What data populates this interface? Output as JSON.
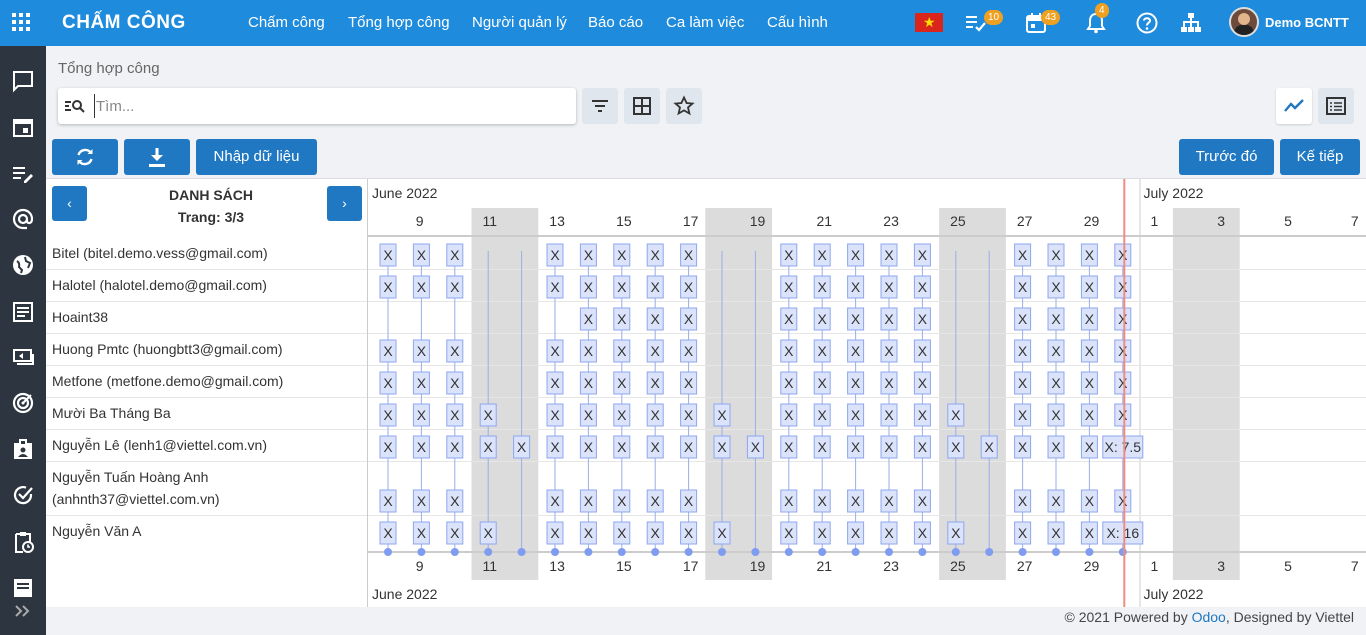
{
  "app": {
    "brand": "CHẤM CÔNG",
    "menu": [
      "Chấm công",
      "Tổng hợp công",
      "Người quản lý",
      "Báo cáo",
      "Ca làm việc",
      "Cấu hình"
    ],
    "badges": {
      "activities": "10",
      "calendar": "43",
      "notifications": "4"
    },
    "user": "Demo BCNTT",
    "accent_color": "#1e8bdc",
    "button_color": "#1f78c1",
    "icons": [
      "apps-grid-icon",
      "vietnam-flag-icon",
      "activity-check-icon",
      "calendar-icon",
      "bell-icon",
      "help-icon",
      "org-chart-icon"
    ]
  },
  "sidebar": {
    "icons": [
      "chat-icon",
      "calendar-icon",
      "notes-icon",
      "at-sign-icon",
      "globe-icon",
      "document-icon",
      "payment-icon",
      "radar-icon",
      "badge-icon",
      "check-circle-icon",
      "clipboard-clock-icon",
      "list-icon"
    ]
  },
  "page": {
    "breadcrumb": "Tổng hợp công",
    "search_placeholder": "Tìm...",
    "import_label": "Nhập dữ liệu",
    "prev_label": "Trước đó",
    "next_label": "Kế tiếp"
  },
  "gantt": {
    "list_title": "DANH SÁCH",
    "page_info": "Trang: 3/3",
    "prev_arrow": "‹",
    "next_arrow": "›",
    "months": [
      "June 2022",
      "July 2022"
    ],
    "day_labels": [
      "9",
      "11",
      "13",
      "15",
      "17",
      "19",
      "21",
      "23",
      "25",
      "27",
      "29",
      "1",
      "3",
      "5",
      "7"
    ],
    "mark_label": "X",
    "rows": [
      {
        "name": "Bitel (bitel.demo.vess@gmail.com)",
        "days": [
          "8",
          "9",
          "10",
          "13",
          "14",
          "15",
          "16",
          "17",
          "20",
          "21",
          "22",
          "23",
          "24",
          "27",
          "28",
          "29",
          "30"
        ]
      },
      {
        "name": "Halotel (halotel.demo@gmail.com)",
        "days": [
          "8",
          "9",
          "10",
          "13",
          "14",
          "15",
          "16",
          "17",
          "20",
          "21",
          "22",
          "23",
          "24",
          "27",
          "28",
          "29",
          "30"
        ]
      },
      {
        "name": "Hoaint38",
        "days": [
          "14",
          "15",
          "16",
          "17",
          "20",
          "21",
          "22",
          "23",
          "24",
          "27",
          "28",
          "29",
          "30"
        ]
      },
      {
        "name": "Huong Pmtc (huongbtt3@gmail.com)",
        "days": [
          "8",
          "9",
          "10",
          "13",
          "14",
          "15",
          "16",
          "17",
          "20",
          "21",
          "22",
          "23",
          "24",
          "27",
          "28",
          "29",
          "30"
        ]
      },
      {
        "name": "Metfone (metfone.demo@gmail.com)",
        "days": [
          "8",
          "9",
          "10",
          "13",
          "14",
          "15",
          "16",
          "17",
          "20",
          "21",
          "22",
          "23",
          "24",
          "27",
          "28",
          "29",
          "30"
        ]
      },
      {
        "name": "Mười Ba Tháng Ba",
        "days": [
          "8",
          "9",
          "10",
          "11",
          "13",
          "14",
          "15",
          "16",
          "17",
          "18",
          "20",
          "21",
          "22",
          "23",
          "24",
          "25",
          "27",
          "28",
          "29",
          "30"
        ]
      },
      {
        "name": "Nguyễn Lê (lenh1@viettel.com.vn)",
        "days": [
          "8",
          "9",
          "10",
          "11",
          "12",
          "13",
          "14",
          "15",
          "16",
          "17",
          "18",
          "19",
          "20",
          "21",
          "22",
          "23",
          "24",
          "25",
          "26",
          "27",
          "28",
          "29"
        ],
        "last": "X: 7.5"
      },
      {
        "name": "Nguyễn Tuấn Hoàng Anh (anhnth37@viettel.com.vn)",
        "days": [
          "8",
          "9",
          "10",
          "13",
          "14",
          "15",
          "16",
          "17",
          "20",
          "21",
          "22",
          "23",
          "24",
          "27",
          "28",
          "29",
          "30"
        ]
      },
      {
        "name": "Nguyễn Văn A",
        "days": [
          "8",
          "9",
          "10",
          "11",
          "13",
          "14",
          "15",
          "16",
          "17",
          "18",
          "20",
          "21",
          "22",
          "23",
          "24",
          "25",
          "27",
          "28",
          "29"
        ],
        "last": "X: 16"
      }
    ]
  },
  "footer": {
    "prefix": "© 2021 Powered by ",
    "link": "Odoo",
    "suffix": ", Designed by Viettel"
  }
}
